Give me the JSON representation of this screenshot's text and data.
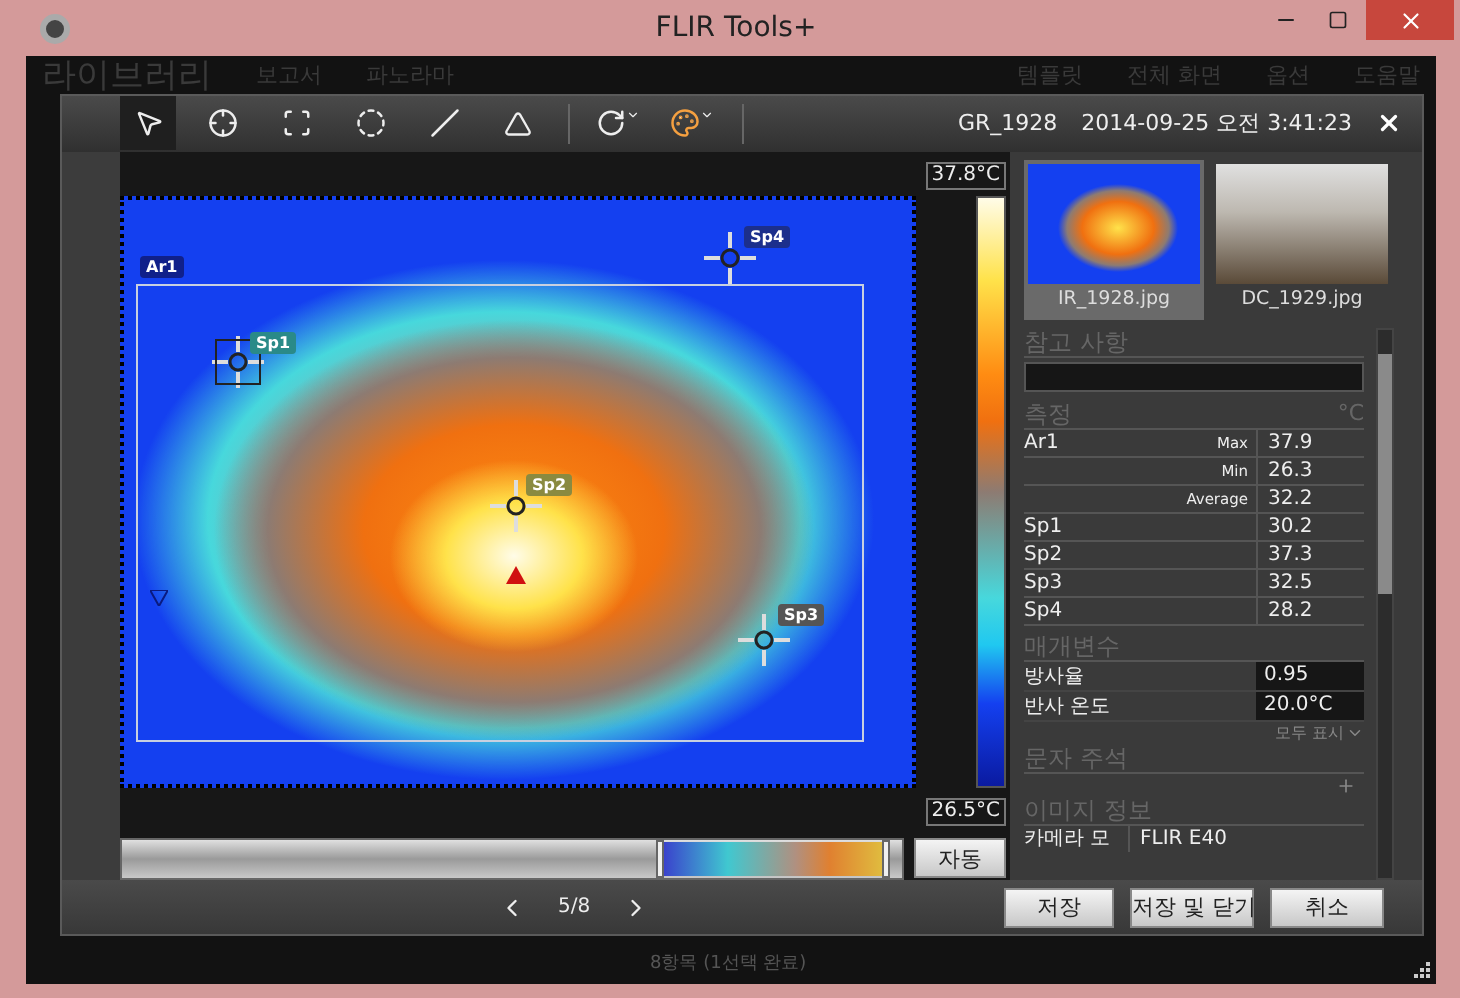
{
  "window": {
    "title": "FLIR Tools+"
  },
  "app_menu": {
    "title": "라이브러리",
    "left": [
      "보고서",
      "파노라마"
    ],
    "right": [
      "템플릿",
      "전체 화면",
      "옵션",
      "도움말"
    ]
  },
  "status_bar": "8항목 (1선택 완료)",
  "toolbar": {
    "tools": [
      {
        "kind": "pointer",
        "selected": true
      },
      {
        "kind": "spot",
        "selected": false
      },
      {
        "kind": "box",
        "selected": false
      },
      {
        "kind": "circle",
        "selected": false
      },
      {
        "kind": "line",
        "selected": false
      },
      {
        "kind": "delta",
        "selected": false
      },
      {
        "kind": "rotate",
        "selected": false
      },
      {
        "kind": "palette",
        "selected": false
      }
    ],
    "file": "GR_1928",
    "timestamp": "2014-09-25 오전 3:41:23"
  },
  "image": {
    "area_label": "Ar1",
    "spots": [
      {
        "label": "Sp1"
      },
      {
        "label": "Sp2"
      },
      {
        "label": "Sp3"
      },
      {
        "label": "Sp4"
      }
    ]
  },
  "scale": {
    "max": "37.8°C",
    "min": "26.5°C",
    "auto_button": "자동",
    "handles": [
      {
        "level": 0.69
      },
      {
        "level": 0.98
      }
    ]
  },
  "thumbnails": [
    {
      "caption": "IR_1928.jpg",
      "kind": "thermal",
      "selected": true
    },
    {
      "caption": "DC_1929.jpg",
      "kind": "photo",
      "selected": false
    }
  ],
  "notes": {
    "heading": "참고 사항"
  },
  "measurements": {
    "heading": "측정",
    "unit": "°C",
    "rows": [
      {
        "name": "Ar1",
        "stat": "Max",
        "value": "37.9"
      },
      {
        "stat": "Min",
        "value": "26.3"
      },
      {
        "stat": "Average",
        "value": "32.2"
      },
      {
        "name": "Sp1",
        "value": "30.2"
      },
      {
        "name": "Sp2",
        "value": "37.3"
      },
      {
        "name": "Sp3",
        "value": "32.5"
      },
      {
        "name": "Sp4",
        "value": "28.2"
      }
    ]
  },
  "parameters": {
    "heading": "매개변수",
    "rows": [
      {
        "label": "방사율",
        "value": "0.95"
      },
      {
        "label": "반사 온도",
        "value": "20.0°C"
      }
    ],
    "show_all": "모두 표시"
  },
  "annotations": {
    "heading": "문자 주석"
  },
  "image_info": {
    "heading": "이미지 정보",
    "rows": [
      {
        "label": "카메라 모",
        "value": "FLIR E40"
      }
    ]
  },
  "pager": "5/8",
  "buttons": [
    "저장",
    "저장 및 닫기",
    "취소"
  ]
}
